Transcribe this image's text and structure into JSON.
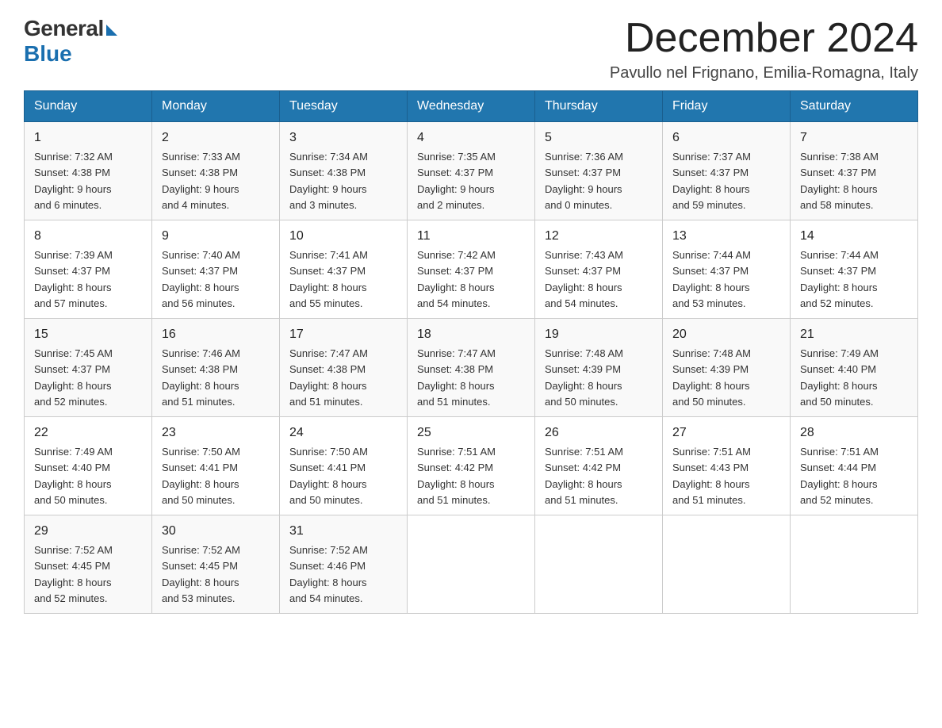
{
  "logo": {
    "general": "General",
    "blue": "Blue"
  },
  "title": "December 2024",
  "location": "Pavullo nel Frignano, Emilia-Romagna, Italy",
  "days_of_week": [
    "Sunday",
    "Monday",
    "Tuesday",
    "Wednesday",
    "Thursday",
    "Friday",
    "Saturday"
  ],
  "weeks": [
    [
      {
        "day": "1",
        "sunrise": "7:32 AM",
        "sunset": "4:38 PM",
        "daylight": "9 hours and 6 minutes."
      },
      {
        "day": "2",
        "sunrise": "7:33 AM",
        "sunset": "4:38 PM",
        "daylight": "9 hours and 4 minutes."
      },
      {
        "day": "3",
        "sunrise": "7:34 AM",
        "sunset": "4:38 PM",
        "daylight": "9 hours and 3 minutes."
      },
      {
        "day": "4",
        "sunrise": "7:35 AM",
        "sunset": "4:37 PM",
        "daylight": "9 hours and 2 minutes."
      },
      {
        "day": "5",
        "sunrise": "7:36 AM",
        "sunset": "4:37 PM",
        "daylight": "9 hours and 0 minutes."
      },
      {
        "day": "6",
        "sunrise": "7:37 AM",
        "sunset": "4:37 PM",
        "daylight": "8 hours and 59 minutes."
      },
      {
        "day": "7",
        "sunrise": "7:38 AM",
        "sunset": "4:37 PM",
        "daylight": "8 hours and 58 minutes."
      }
    ],
    [
      {
        "day": "8",
        "sunrise": "7:39 AM",
        "sunset": "4:37 PM",
        "daylight": "8 hours and 57 minutes."
      },
      {
        "day": "9",
        "sunrise": "7:40 AM",
        "sunset": "4:37 PM",
        "daylight": "8 hours and 56 minutes."
      },
      {
        "day": "10",
        "sunrise": "7:41 AM",
        "sunset": "4:37 PM",
        "daylight": "8 hours and 55 minutes."
      },
      {
        "day": "11",
        "sunrise": "7:42 AM",
        "sunset": "4:37 PM",
        "daylight": "8 hours and 54 minutes."
      },
      {
        "day": "12",
        "sunrise": "7:43 AM",
        "sunset": "4:37 PM",
        "daylight": "8 hours and 54 minutes."
      },
      {
        "day": "13",
        "sunrise": "7:44 AM",
        "sunset": "4:37 PM",
        "daylight": "8 hours and 53 minutes."
      },
      {
        "day": "14",
        "sunrise": "7:44 AM",
        "sunset": "4:37 PM",
        "daylight": "8 hours and 52 minutes."
      }
    ],
    [
      {
        "day": "15",
        "sunrise": "7:45 AM",
        "sunset": "4:37 PM",
        "daylight": "8 hours and 52 minutes."
      },
      {
        "day": "16",
        "sunrise": "7:46 AM",
        "sunset": "4:38 PM",
        "daylight": "8 hours and 51 minutes."
      },
      {
        "day": "17",
        "sunrise": "7:47 AM",
        "sunset": "4:38 PM",
        "daylight": "8 hours and 51 minutes."
      },
      {
        "day": "18",
        "sunrise": "7:47 AM",
        "sunset": "4:38 PM",
        "daylight": "8 hours and 51 minutes."
      },
      {
        "day": "19",
        "sunrise": "7:48 AM",
        "sunset": "4:39 PM",
        "daylight": "8 hours and 50 minutes."
      },
      {
        "day": "20",
        "sunrise": "7:48 AM",
        "sunset": "4:39 PM",
        "daylight": "8 hours and 50 minutes."
      },
      {
        "day": "21",
        "sunrise": "7:49 AM",
        "sunset": "4:40 PM",
        "daylight": "8 hours and 50 minutes."
      }
    ],
    [
      {
        "day": "22",
        "sunrise": "7:49 AM",
        "sunset": "4:40 PM",
        "daylight": "8 hours and 50 minutes."
      },
      {
        "day": "23",
        "sunrise": "7:50 AM",
        "sunset": "4:41 PM",
        "daylight": "8 hours and 50 minutes."
      },
      {
        "day": "24",
        "sunrise": "7:50 AM",
        "sunset": "4:41 PM",
        "daylight": "8 hours and 50 minutes."
      },
      {
        "day": "25",
        "sunrise": "7:51 AM",
        "sunset": "4:42 PM",
        "daylight": "8 hours and 51 minutes."
      },
      {
        "day": "26",
        "sunrise": "7:51 AM",
        "sunset": "4:42 PM",
        "daylight": "8 hours and 51 minutes."
      },
      {
        "day": "27",
        "sunrise": "7:51 AM",
        "sunset": "4:43 PM",
        "daylight": "8 hours and 51 minutes."
      },
      {
        "day": "28",
        "sunrise": "7:51 AM",
        "sunset": "4:44 PM",
        "daylight": "8 hours and 52 minutes."
      }
    ],
    [
      {
        "day": "29",
        "sunrise": "7:52 AM",
        "sunset": "4:45 PM",
        "daylight": "8 hours and 52 minutes."
      },
      {
        "day": "30",
        "sunrise": "7:52 AM",
        "sunset": "4:45 PM",
        "daylight": "8 hours and 53 minutes."
      },
      {
        "day": "31",
        "sunrise": "7:52 AM",
        "sunset": "4:46 PM",
        "daylight": "8 hours and 54 minutes."
      },
      null,
      null,
      null,
      null
    ]
  ],
  "labels": {
    "sunrise": "Sunrise:",
    "sunset": "Sunset:",
    "daylight": "Daylight:"
  }
}
